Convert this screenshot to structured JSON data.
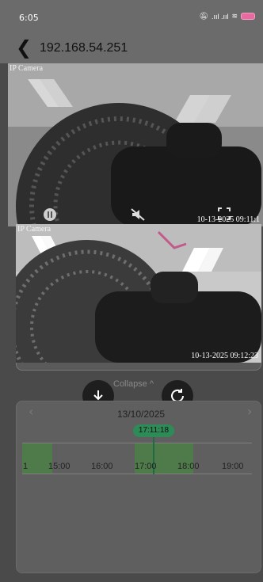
{
  "status_bar": {
    "time": "6:05",
    "signal": ".ııl .ııl"
  },
  "header": {
    "title": "192.168.54.251",
    "back_icon": "chevron-left-icon"
  },
  "stream_main": {
    "camera_label": "IP Camera",
    "timestamp": "10-13-2025 09:11:1"
  },
  "stream_playback": {
    "camera_label": "IP Camera",
    "timestamp": "10-13-2025  09:12:23"
  },
  "panel": {
    "collapse_label": "Collapse ^"
  },
  "timeline": {
    "date": "13/10/2025",
    "current_time": "17:11:18",
    "ticks": [
      "1",
      "15:00",
      "16:00",
      "17:00",
      "18:00",
      "19:00"
    ],
    "prev_icon": "chevron-left-icon",
    "next_icon": "chevron-right-icon"
  },
  "colors": {
    "accent_green": "#2e8a57",
    "battery": "#e86aa0"
  }
}
